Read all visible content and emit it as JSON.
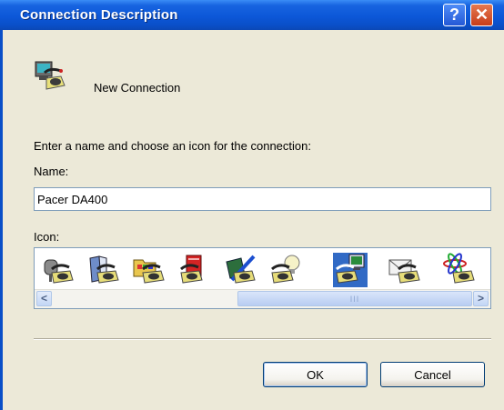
{
  "window": {
    "title": "Connection Description",
    "help_symbol": "?",
    "close_symbol": "✕"
  },
  "header": {
    "label": "New Connection",
    "icon": "phone-connection-icon"
  },
  "prompt": "Enter a name and choose an icon for the connection:",
  "name": {
    "label": "Name:",
    "value": "Pacer DA400"
  },
  "icon_picker": {
    "label": "Icon:",
    "icons": [
      "phone-mailbox-icon",
      "phone-book-icon",
      "phone-folder-icon",
      "phone-redbook-icon",
      "phone-pen-icon",
      "phone-bulb-icon",
      "phone-computer-icon",
      "phone-envelope-icon",
      "phone-atom-icon"
    ],
    "selected_index": 6,
    "scroll_left": "<",
    "scroll_right": ">",
    "thumb_grip": "III"
  },
  "buttons": {
    "ok": "OK",
    "cancel": "Cancel"
  },
  "colors": {
    "titlebar": "#0a4fc8",
    "dialog_bg": "#ece9d8",
    "selection": "#316ac5"
  }
}
